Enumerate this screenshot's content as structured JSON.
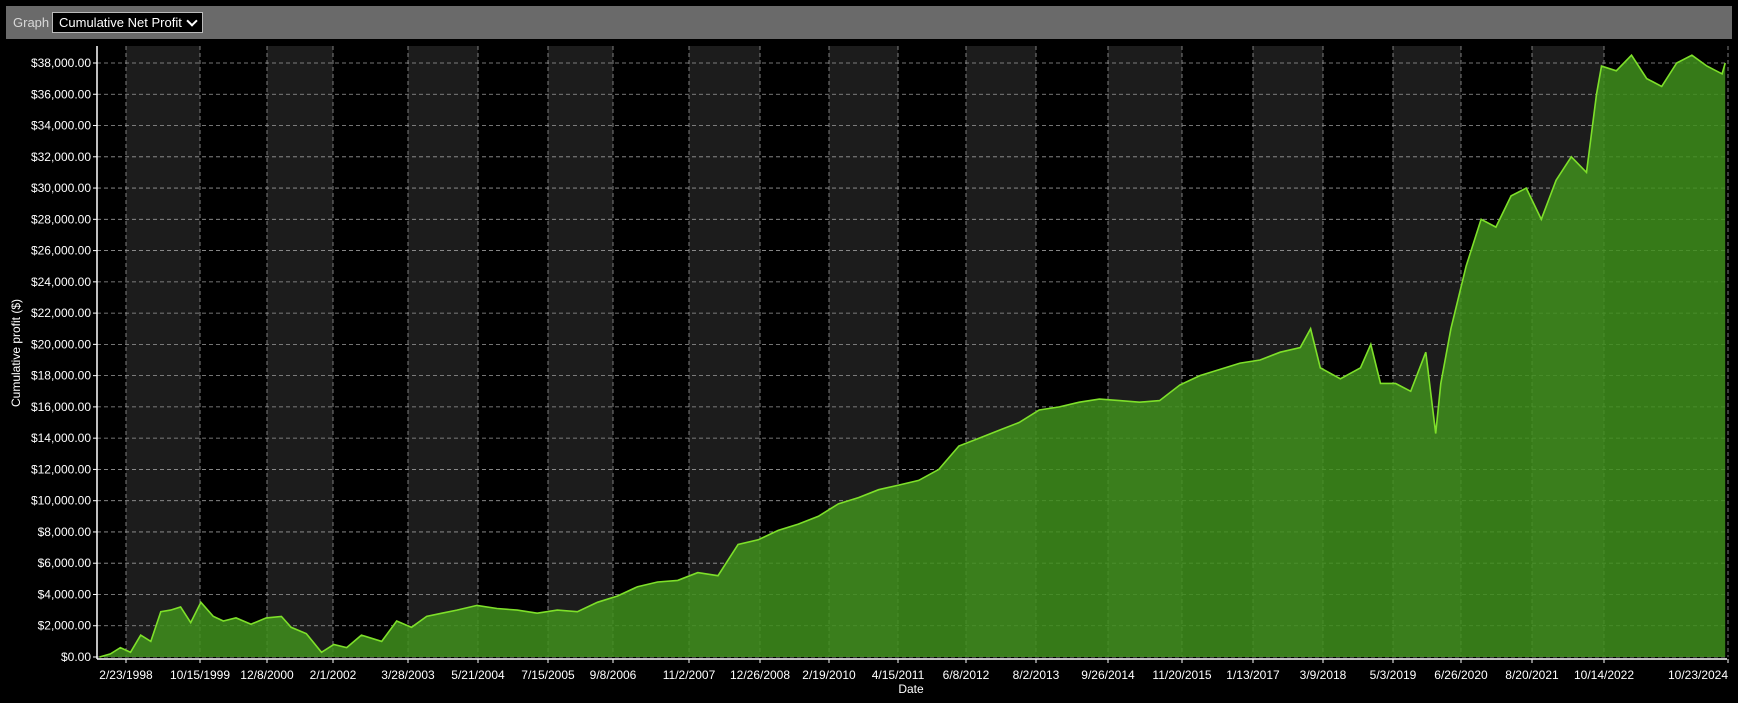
{
  "toolbar": {
    "label": "Graph",
    "selected": "Cumulative Net Profit"
  },
  "chart_data": {
    "type": "area",
    "xlabel": "Date",
    "ylabel": "Cumulative profit ($)",
    "ylim": [
      0,
      38000
    ],
    "grid": true,
    "y_tick_labels": [
      "$0.00",
      "$2,000.00",
      "$4,000.00",
      "$6,000.00",
      "$8,000.00",
      "$10,000.00",
      "$12,000.00",
      "$14,000.00",
      "$16,000.00",
      "$18,000.00",
      "$20,000.00",
      "$22,000.00",
      "$24,000.00",
      "$26,000.00",
      "$28,000.00",
      "$30,000.00",
      "$32,000.00",
      "$34,000.00",
      "$36,000.00",
      "$38,000.00"
    ],
    "x_tick_labels": [
      "2/23/1998",
      "10/15/1999",
      "12/8/2000",
      "2/1/2002",
      "3/28/2003",
      "5/21/2004",
      "7/15/2005",
      "9/8/2006",
      "11/2/2007",
      "12/26/2008",
      "2/19/2010",
      "4/15/2011",
      "6/8/2012",
      "8/2/2013",
      "9/26/2014",
      "11/20/2015",
      "1/13/2017",
      "3/9/2018",
      "5/3/2019",
      "6/26/2020",
      "8/20/2021",
      "10/14/2022",
      "10/23/2024"
    ],
    "colors": {
      "line": "#7ee02a",
      "fill": "#3f8f1c",
      "band": "#1c1c1c",
      "background": "#000000"
    },
    "series": [
      {
        "x": [
          "1997-12-25",
          "1998-03-01",
          "1998-05-01",
          "1998-07-01",
          "1998-09-01",
          "1998-11-01",
          "1999-01-01",
          "1999-03-01",
          "1999-05-01",
          "1999-07-01",
          "1999-09-01",
          "1999-11-15",
          "2000-01-15",
          "2000-04-01",
          "2000-07-01",
          "2000-10-01",
          "2001-01-01",
          "2001-03-01",
          "2001-06-01",
          "2001-09-01",
          "2001-11-15",
          "2002-02-01",
          "2002-05-01",
          "2002-09-01",
          "2002-12-01",
          "2003-03-01",
          "2003-06-01",
          "2003-09-01",
          "2003-12-01",
          "2004-04-01",
          "2004-08-01",
          "2004-12-01",
          "2005-04-01",
          "2005-08-01",
          "2005-12-01",
          "2006-04-01",
          "2006-08-01",
          "2006-12-01",
          "2007-04-01",
          "2007-08-01",
          "2007-12-01",
          "2008-04-01",
          "2008-08-01",
          "2008-12-01",
          "2009-04-01",
          "2009-08-01",
          "2009-12-01",
          "2010-04-01",
          "2010-08-01",
          "2010-12-01",
          "2011-04-01",
          "2011-08-01",
          "2011-12-01",
          "2012-04-01",
          "2012-08-01",
          "2012-12-01",
          "2013-04-01",
          "2013-08-01",
          "2013-12-01",
          "2014-04-01",
          "2014-08-01",
          "2014-12-01",
          "2015-04-01",
          "2015-08-01",
          "2015-12-01",
          "2016-04-01",
          "2016-08-01",
          "2016-12-01",
          "2017-04-01",
          "2017-08-01",
          "2017-12-01",
          "2018-02-01",
          "2018-04-01",
          "2018-08-01",
          "2018-12-01",
          "2019-02-01",
          "2019-04-01",
          "2019-07-01",
          "2019-10-01",
          "2020-01-01",
          "2020-03-01",
          "2020-04-01",
          "2020-06-01",
          "2020-09-01",
          "2020-12-01",
          "2021-03-01",
          "2021-06-01",
          "2021-09-01",
          "2021-12-01",
          "2022-03-01",
          "2022-06-01",
          "2022-09-01",
          "2022-11-01",
          "2022-12-01",
          "2023-03-01",
          "2023-06-01",
          "2023-09-01",
          "2023-12-01",
          "2024-03-01",
          "2024-06-01",
          "2024-09-01",
          "2024-12-01",
          "2024-12-20"
        ],
        "values": [
          0,
          200,
          600,
          300,
          1400,
          1000,
          2900,
          3000,
          3200,
          2200,
          3500,
          2600,
          2300,
          2500,
          2100,
          2500,
          2600,
          1900,
          1500,
          300,
          800,
          600,
          1400,
          1000,
          2300,
          1900,
          2600,
          2800,
          3000,
          3300,
          3100,
          3000,
          2800,
          3000,
          2900,
          3500,
          3900,
          4500,
          4800,
          4900,
          5400,
          5200,
          7200,
          7500,
          8100,
          8500,
          9000,
          9800,
          10200,
          10700,
          11000,
          11300,
          12000,
          13500,
          14000,
          14500,
          15000,
          15800,
          16000,
          16300,
          16500,
          16400,
          16300,
          16400,
          17400,
          18000,
          18400,
          18800,
          19000,
          19500,
          19800,
          21000,
          18500,
          17800,
          18500,
          20000,
          17500,
          17500,
          17000,
          19500,
          14300,
          17500,
          21000,
          25000,
          28000,
          27500,
          29500,
          30000,
          28000,
          30500,
          32000,
          31000,
          36000,
          37800,
          37500,
          38500,
          37000,
          36500,
          38000,
          38500,
          37800,
          37300,
          38000
        ]
      }
    ]
  }
}
